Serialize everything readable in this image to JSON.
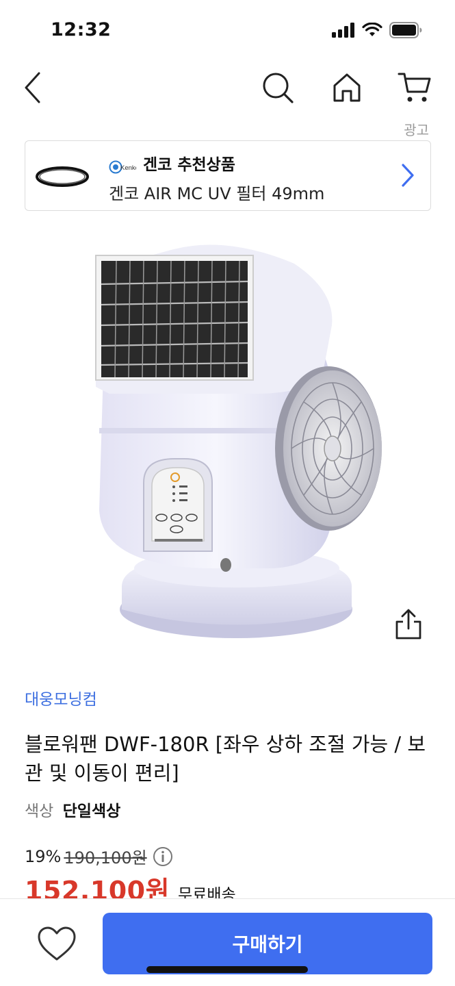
{
  "status_bar": {
    "time": "12:32",
    "icons": [
      "signal-icon",
      "wifi-icon",
      "battery-icon"
    ]
  },
  "nav": {
    "icons": [
      "back-icon",
      "search-icon",
      "home-icon",
      "cart-icon"
    ]
  },
  "ad": {
    "label": "광고",
    "logo_text": "Kenko",
    "title": "겐코 추천상품",
    "subtitle": "겐코 AIR MC UV 필터 49mm"
  },
  "product": {
    "seller": "대웅모닝컴",
    "title": "블로워팬 DWF-180R [좌우 상하 조절 가능 / 보관 및 이동이 편리]",
    "option_label": "색상",
    "option_value": "단일색상",
    "discount": "19%",
    "original_price": "190,100원",
    "sale_price": "152,100원",
    "shipping": "무료배송"
  },
  "bottom_bar": {
    "buy_label": "구매하기"
  },
  "colors": {
    "accent": "#3f6ef0",
    "seller_link": "#3d6fe0",
    "sale_price": "#d8382a"
  }
}
